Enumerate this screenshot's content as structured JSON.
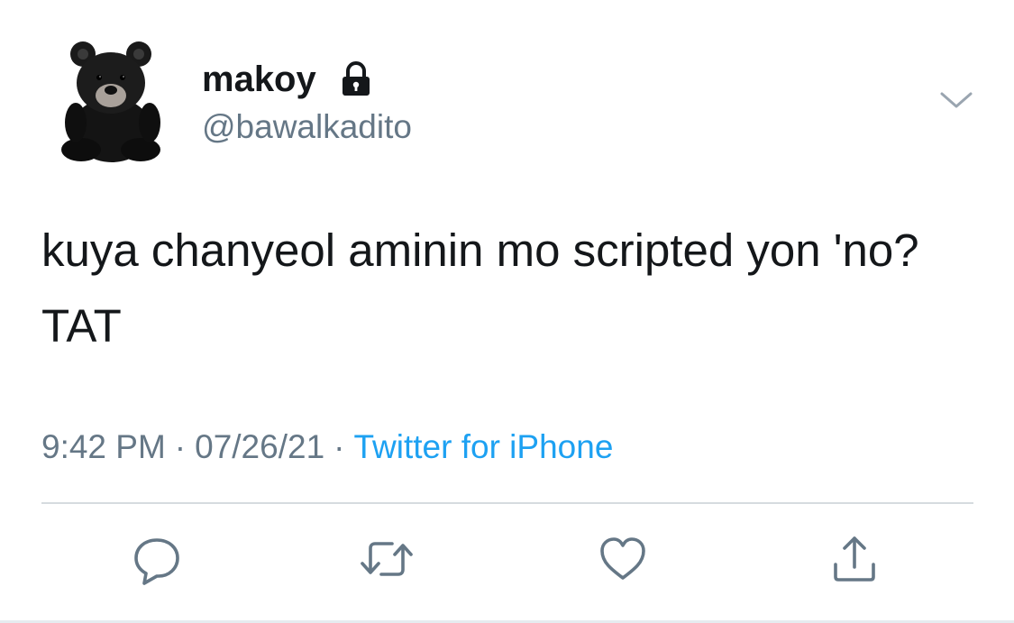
{
  "author": {
    "display_name": "makoy",
    "handle": "@bawalkadito",
    "protected_icon": "lock-icon",
    "avatar": "black-teddy-bear"
  },
  "tweet": {
    "text": "kuya chanyeol aminin mo scripted yon 'no? TAT"
  },
  "meta": {
    "time": "9:42 PM",
    "separator": "·",
    "date": "07/26/21",
    "source": "Twitter for iPhone"
  },
  "actions": [
    "reply-icon",
    "retweet-icon",
    "like-icon",
    "share-icon"
  ],
  "colors": {
    "text": "#14171a",
    "secondary": "#657786",
    "link": "#1da1f2",
    "divider": "#d6dbdf"
  }
}
